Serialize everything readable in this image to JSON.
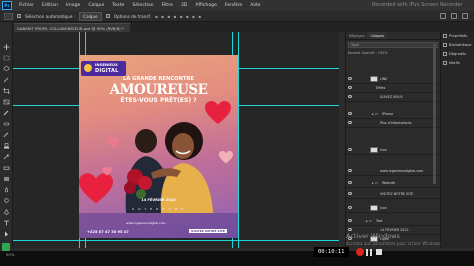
{
  "app": {
    "logo": "Ps",
    "menu": [
      "Fichier",
      "Edition",
      "Image",
      "Calque",
      "Texte",
      "Sélection",
      "Filtre",
      "3D",
      "Affichage",
      "Fenêtre",
      "Aide"
    ],
    "recorder_overlay": "Recorded with iFun Screen Recorder"
  },
  "options_bar": {
    "select_label": "Sélection automatique :",
    "select_value": "Calque",
    "show_transform_label": "Options de transf."
  },
  "document": {
    "tab_title": "GABARIT PROFIL COLLABORATEUR.psd @ 50% (RVB/8) *"
  },
  "artwork": {
    "logo_top": "INGENIEUX",
    "logo_bottom": "DIGITAL",
    "headline_1": "LA GRANDE RENCONTRE",
    "headline_2": "AMOUREUSE",
    "headline_3": "ÊTES-VOUS PRÊT(ES) ?",
    "date": "14 FÉVRIER 2022",
    "subtitle": "S O Y E Z   N O M B",
    "website": "www.ingenieuxdigital.com",
    "phone": "+225 07 47 35 95 47",
    "cta": "VISITEZ NOTRE SITE"
  },
  "layers_panel": {
    "tabs": [
      "Réglages",
      "Calques"
    ],
    "active_tab": "Calques",
    "search_placeholder": "Type",
    "options_text": "Normal       Opacité : 100%",
    "layers": [
      {
        "name": "LINE",
        "selected": false,
        "kind": "thumb"
      },
      {
        "name": "Effets",
        "selected": false,
        "kind": "fx"
      },
      {
        "name": "SUIVEZ NOUS",
        "selected": false,
        "kind": "text"
      },
      {
        "name": "iPhone",
        "selected": false,
        "kind": "folder"
      },
      {
        "name": "Plus d'informations",
        "selected": false,
        "kind": "text"
      },
      {
        "name": "Icon",
        "selected": false,
        "kind": "thumb"
      },
      {
        "name": "www.ingenieuxdigital.com",
        "selected": false,
        "kind": "text"
      },
      {
        "name": "Website",
        "selected": false,
        "kind": "folder"
      },
      {
        "name": "VISITEZ NOTRE SITE",
        "selected": false,
        "kind": "text"
      },
      {
        "name": "Icon",
        "selected": false,
        "kind": "thumb"
      },
      {
        "name": "Text",
        "selected": false,
        "kind": "folder"
      },
      {
        "name": "14 FÉVRIER 2022",
        "selected": false,
        "kind": "text"
      },
      {
        "name": "Ligne",
        "selected": false,
        "kind": "thumb"
      }
    ]
  },
  "props_panel": {
    "items": [
      "Propriétés",
      "Bibliothèque",
      "Dégradés",
      "Motifs"
    ]
  },
  "status": {
    "zoom": "50%",
    "timecode": "00:10:11",
    "watermark": "Activer Windows",
    "watermark_sub": "Accédez aux paramètres pour activer Windows."
  },
  "colors": {
    "accent": "#31a8ff",
    "guide": "#1fd7d7",
    "artwork_purple": "#5b3e8f",
    "record_red": "#d9261c"
  }
}
